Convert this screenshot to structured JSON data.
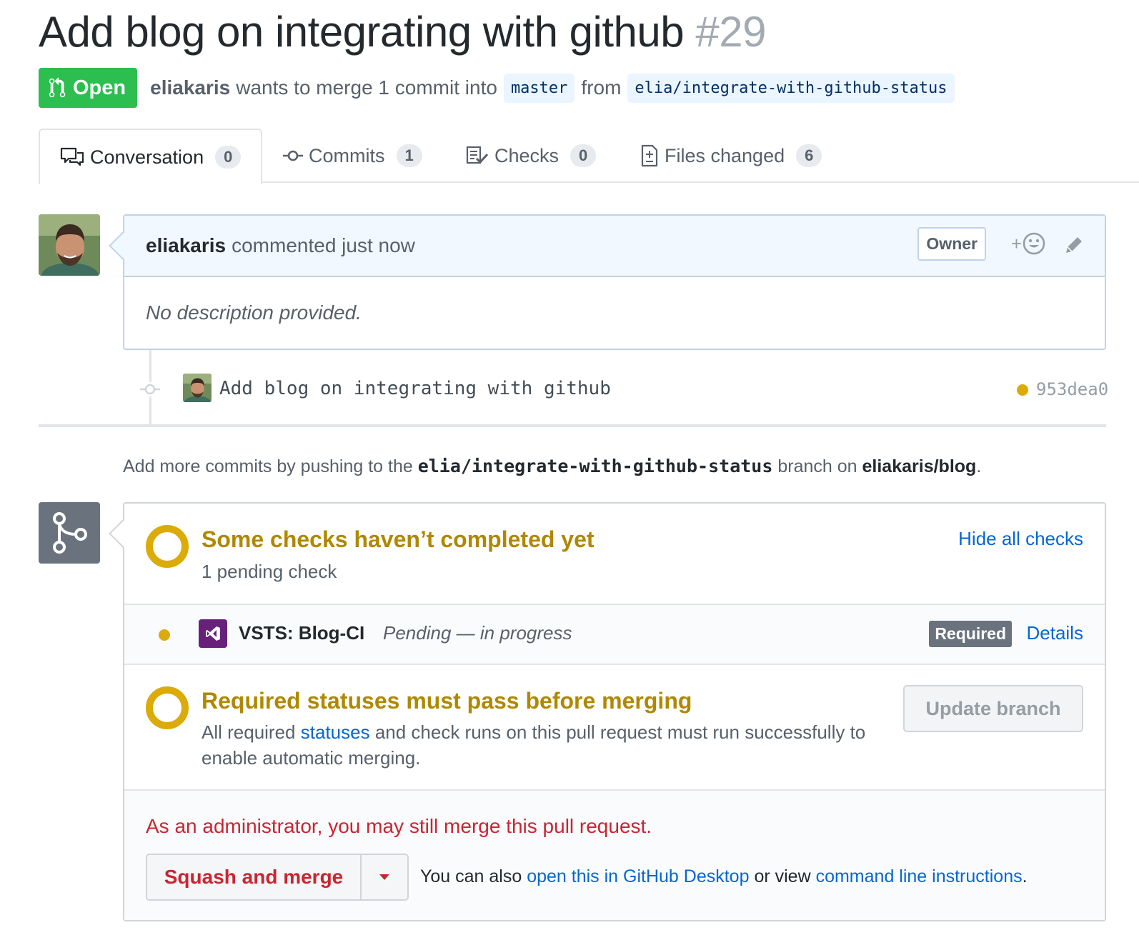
{
  "pr": {
    "title": "Add blog on integrating with github",
    "number": "#29",
    "state": "Open",
    "author": "eliakaris",
    "merge_text": "wants to merge 1 commit into",
    "base_branch": "master",
    "from_text": "from",
    "head_branch": "elia/integrate-with-github-status"
  },
  "tabs": [
    {
      "label": "Conversation",
      "count": "0",
      "icon": "comment-discussion-icon"
    },
    {
      "label": "Commits",
      "count": "1",
      "icon": "git-commit-icon"
    },
    {
      "label": "Checks",
      "count": "0",
      "icon": "checklist-icon"
    },
    {
      "label": "Files changed",
      "count": "6",
      "icon": "diff-icon"
    }
  ],
  "comment": {
    "author": "eliakaris",
    "action": "commented just now",
    "badge": "Owner",
    "reaction_plus": "+",
    "body": "No description provided."
  },
  "commit": {
    "message": "Add blog on integrating with github",
    "sha": "953dea0",
    "status_color": "#dbab09"
  },
  "push_note": {
    "prefix": "Add more commits by pushing to the",
    "branch": "elia/integrate-with-github-status",
    "middle": "branch on",
    "repo": "eliakaris/blog",
    "suffix": "."
  },
  "checks": {
    "heading": "Some checks haven’t completed yet",
    "sub": "1 pending check",
    "toggle": "Hide all checks",
    "items": [
      {
        "name": "VSTS: Blog-CI",
        "status": "Pending — in progress",
        "badge": "Required",
        "link": "Details"
      }
    ]
  },
  "required": {
    "heading": "Required statuses must pass before merging",
    "body_pre": "All required",
    "body_link": "statuses",
    "body_post": "and check runs on this pull request must run successfully to enable automatic merging.",
    "button": "Update branch"
  },
  "merge": {
    "admin_note": "As an administrator, you may still merge this pull request.",
    "button": "Squash and merge",
    "also_pre": "You can also",
    "desktop_link": "open this in GitHub Desktop",
    "also_mid": "or view",
    "cli_link": "command line instructions",
    "also_post": "."
  },
  "colors": {
    "open_green": "#2cbe4e",
    "pending_yellow": "#dbab09",
    "heading_yellow": "#b08800",
    "link_blue": "#0366d6",
    "danger_red": "#cb2431"
  }
}
